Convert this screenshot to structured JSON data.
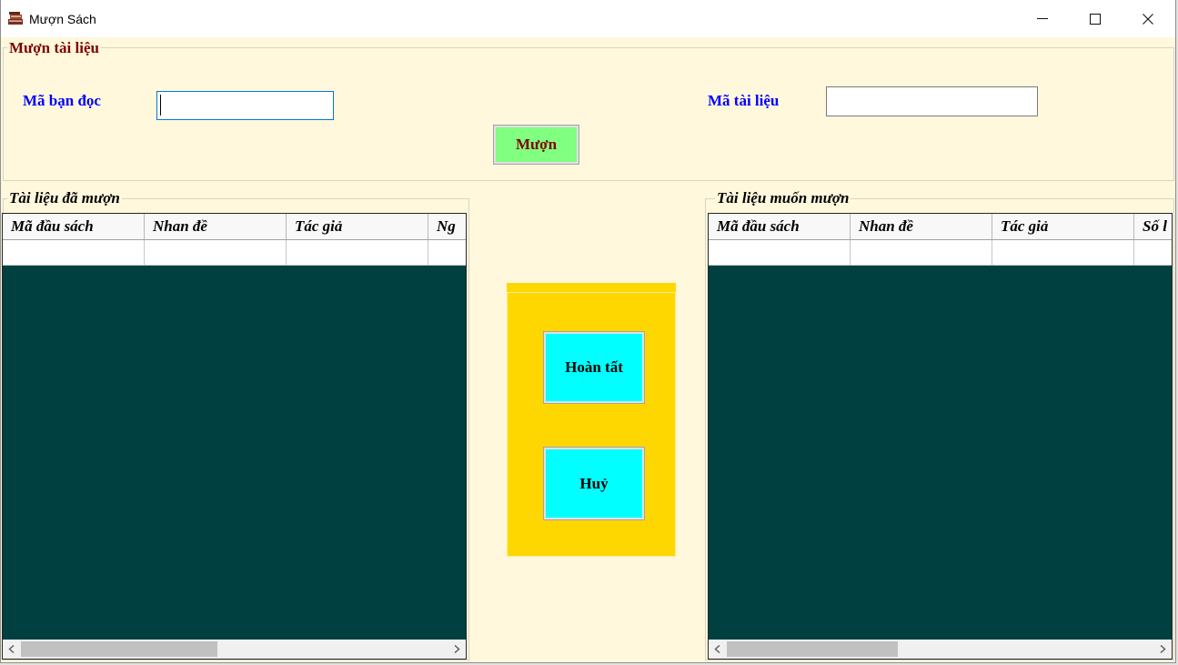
{
  "window": {
    "title": "Mượn Sách"
  },
  "icons": {
    "app": "books-icon",
    "minimize": "minimize-icon",
    "maximize": "maximize-icon",
    "close": "close-icon",
    "scroll_left": "chevron-left-icon",
    "scroll_right": "chevron-right-icon"
  },
  "borrow_group": {
    "title": "Mượn tài liệu",
    "reader_id_label": "Mã bạn đọc",
    "reader_id_value": "",
    "document_id_label": "Mã tài liệu",
    "document_id_value": "",
    "borrow_button": "Mượn"
  },
  "borrowed_group": {
    "title": "Tài liệu đã mượn",
    "columns": [
      "Mã đầu sách",
      "Nhan đề",
      "Tác giả",
      "Ng"
    ],
    "rows": [
      [
        "",
        "",
        "",
        ""
      ]
    ],
    "scroll": {
      "offset_percent": 0,
      "visible_percent": 46
    }
  },
  "action_panel": {
    "complete_button": "Hoàn tất",
    "cancel_button": "Huỷ"
  },
  "wanted_group": {
    "title": "Tài liệu muốn mượn",
    "columns": [
      "Mã đầu sách",
      "Nhan đề",
      "Tác giả",
      "Số l"
    ],
    "rows": [
      [
        "",
        "",
        "",
        ""
      ]
    ],
    "scroll": {
      "offset_percent": 0,
      "visible_percent": 40
    }
  },
  "colors": {
    "form_background": "#FFF8DC",
    "title_text": "#800000",
    "label_text": "#0000FF",
    "grid_background": "#004040",
    "action_panel": "#FFD700",
    "action_button": "#00FFFF",
    "borrow_button": "#80FF80"
  }
}
